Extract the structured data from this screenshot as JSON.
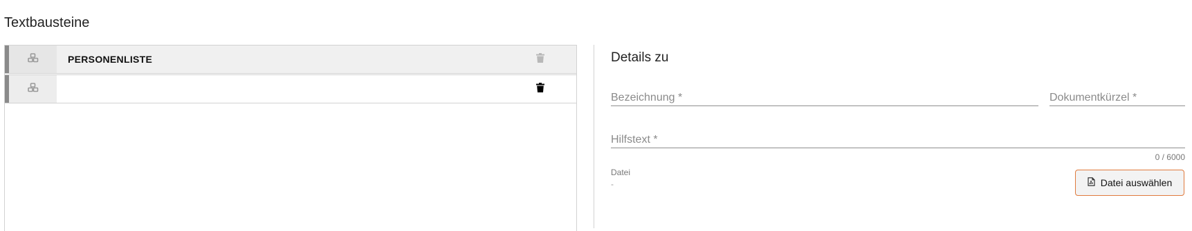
{
  "page": {
    "title": "Textbausteine"
  },
  "list": {
    "items": [
      {
        "label": "PERSONENLISTE",
        "icon": "cubes-icon",
        "delete_icon": "trash-icon",
        "selected": true,
        "delete_enabled": false
      },
      {
        "label": "",
        "icon": "cubes-icon",
        "delete_icon": "trash-icon",
        "selected": false,
        "delete_enabled": true
      }
    ]
  },
  "details": {
    "title": "Details zu",
    "fields": {
      "bezeichnung": {
        "placeholder": "Bezeichnung *",
        "value": ""
      },
      "dokumentkuerzel": {
        "placeholder": "Dokumentkürzel *",
        "value": ""
      },
      "hilfstext": {
        "placeholder": "Hilfstext *",
        "value": "",
        "counter": "0 / 6000"
      }
    },
    "datei": {
      "label": "Datei",
      "value": "-",
      "button_label": "Datei auswählen",
      "button_icon": "pdf-file-icon"
    }
  },
  "colors": {
    "accent_border": "#e07a3c",
    "row_bar": "#8a8a8a",
    "icon_disabled": "#b8b8b8",
    "icon_enabled": "#000000"
  }
}
